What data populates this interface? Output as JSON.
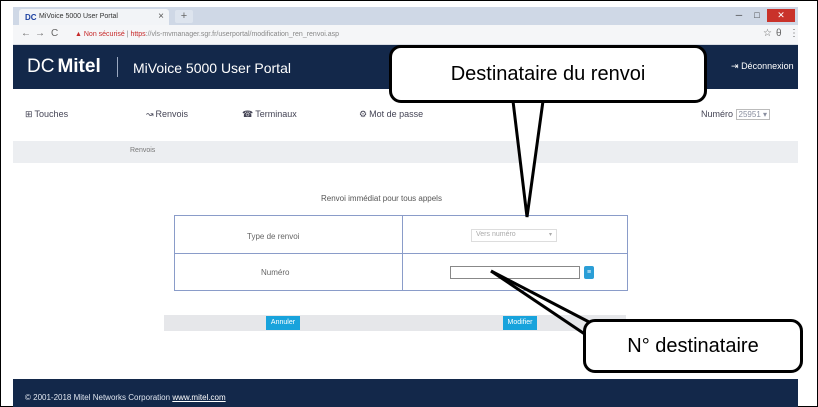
{
  "browser": {
    "tab_title": "MiVoice 5000 User Portal",
    "tab_close": "×",
    "new_tab": "+",
    "favicon_text": "DC",
    "win_min": "─",
    "win_max": "□",
    "win_close": "✕",
    "back_icon": "←",
    "forward_icon": "→",
    "reload_icon": "C",
    "security_label": "Non sécurisé",
    "url_scheme": "https",
    "url_rest": "://vls-mvmanager.sgr.fr/userportal/modification_ren_renvoi.asp",
    "star_icon": "☆",
    "account_icon": "θ",
    "menu_icon": "⋮"
  },
  "header": {
    "logo_mark": "DC",
    "logo_text": "Mitel",
    "portal_title": "MiVoice 5000 User Portal",
    "logout_icon": "⇥",
    "logout_label": "Déconnexion"
  },
  "nav": {
    "items": [
      {
        "icon": "⊞",
        "label": "Touches"
      },
      {
        "icon": "↝",
        "label": "Renvois"
      },
      {
        "icon": "☎",
        "label": "Terminaux"
      },
      {
        "icon": "⚙",
        "label": "Mot de passe"
      }
    ],
    "numero_label": "Numéro",
    "numero_value": "25951",
    "numero_caret": "▾"
  },
  "breadcrumb": {
    "label": "Renvois"
  },
  "form": {
    "title": "Renvoi immédiat pour tous appels",
    "type_label": "Type de renvoi",
    "type_value": "Vers numéro",
    "type_caret": "▾",
    "numero_label": "Numéro",
    "numero_value": "",
    "directory_icon": "≡",
    "cancel_label": "Annuler",
    "modify_label": "Modifier"
  },
  "footer": {
    "copyright": "© 2001-2018 Mitel Networks Corporation",
    "link_text": "www.mitel.com"
  },
  "annotations": {
    "callout_destination": "Destinataire du renvoi",
    "callout_number": "N° destinataire"
  }
}
